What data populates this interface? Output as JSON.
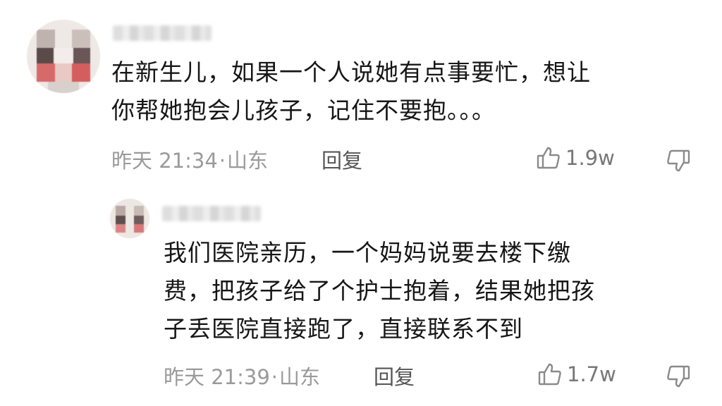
{
  "comments": [
    {
      "text": "在新生儿，如果一个人说她有点事要忙，想让\n你帮她抱会儿孩子，记住不要抱。。。",
      "time": "昨天 21:34",
      "separator": "·",
      "location": "山东",
      "reply_label": "回复",
      "like_count": "1.9w"
    },
    {
      "text": "我们医院亲历，一个妈妈说要去楼下缴\n费，把孩子给了个护士抱着，结果她把孩\n子丢医院直接跑了，直接联系不到",
      "time": "昨天 21:39",
      "separator": "·",
      "location": "山东",
      "reply_label": "回复",
      "like_count": "1.7w"
    }
  ],
  "icons": {
    "like": "thumbs-up-icon",
    "dislike": "thumbs-down-icon"
  },
  "colors": {
    "text": "#161616",
    "meta": "#9a9a9a",
    "reply": "#555555",
    "icon": "#8a8a8a"
  }
}
